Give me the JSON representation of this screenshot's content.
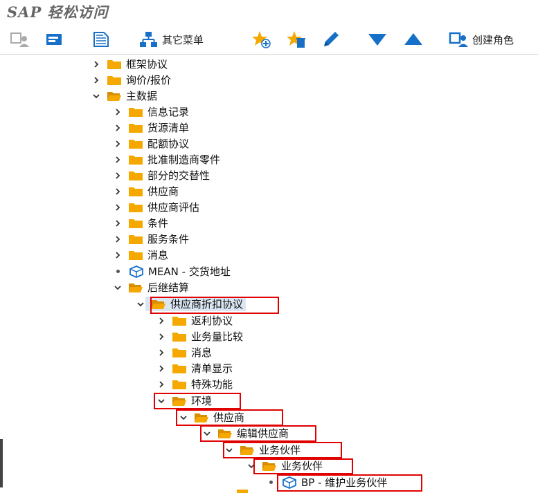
{
  "app": {
    "title": "SAP 轻松访问"
  },
  "toolbar": {
    "other_menu_label": "其它菜单",
    "create_role_label": "创建角色"
  },
  "tree": [
    {
      "label": "框架协议",
      "expanded": false
    },
    {
      "label": "询价/报价",
      "expanded": false
    },
    {
      "label": "主数据",
      "expanded": true
    },
    {
      "label": "信息记录",
      "expanded": false
    },
    {
      "label": "货源清单",
      "expanded": false
    },
    {
      "label": "配额协议",
      "expanded": false
    },
    {
      "label": "批准制造商零件",
      "expanded": false
    },
    {
      "label": "部分的交替性",
      "expanded": false
    },
    {
      "label": "供应商",
      "expanded": false
    },
    {
      "label": "供应商评估",
      "expanded": false
    },
    {
      "label": "条件",
      "expanded": false
    },
    {
      "label": "服务条件",
      "expanded": false
    },
    {
      "label": "消息",
      "expanded": false
    },
    {
      "label": "MEAN - 交货地址",
      "type": "transaction"
    },
    {
      "label": "后继结算",
      "expanded": true
    },
    {
      "label": "供应商折扣协议",
      "expanded": true,
      "selected": true
    },
    {
      "label": "返利协议",
      "expanded": false
    },
    {
      "label": "业务量比较",
      "expanded": false
    },
    {
      "label": "消息",
      "expanded": false
    },
    {
      "label": "清单显示",
      "expanded": false
    },
    {
      "label": "特殊功能",
      "expanded": false
    },
    {
      "label": "环境",
      "expanded": true
    },
    {
      "label": "供应商",
      "expanded": true
    },
    {
      "label": "编辑供应商",
      "expanded": true
    },
    {
      "label": "业务伙伴",
      "expanded": true
    },
    {
      "label": "业务伙伴",
      "expanded": true
    },
    {
      "label": "BP - 维护业务伙伴",
      "type": "transaction"
    }
  ],
  "colors": {
    "folder": "#f5a800",
    "accent_blue": "#1670c8",
    "highlight_red": "#e00000"
  }
}
